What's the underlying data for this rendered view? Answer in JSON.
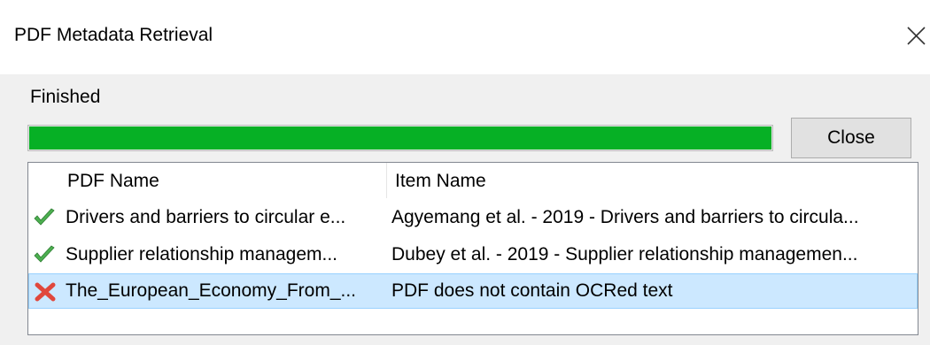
{
  "window": {
    "title": "PDF Metadata Retrieval"
  },
  "status": {
    "text": "Finished",
    "progress_percent": 100,
    "progress_color": "#06b025"
  },
  "buttons": {
    "close_label": "Close"
  },
  "table": {
    "columns": [
      "PDF Name",
      "Item Name"
    ],
    "rows": [
      {
        "status_icon": "check-icon",
        "pdf_name": "Drivers and barriers to circular e...",
        "item_name": "Agyemang et al. - 2019 - Drivers and barriers to circula...",
        "selected": false
      },
      {
        "status_icon": "check-icon",
        "pdf_name": "Supplier relationship managem...",
        "item_name": "Dubey et al. - 2019 - Supplier relationship managemen...",
        "selected": false
      },
      {
        "status_icon": "error-x-icon",
        "pdf_name": "The_European_Economy_From_...",
        "item_name": "PDF does not contain OCRed text",
        "selected": true
      }
    ]
  },
  "colors": {
    "selection_bg": "#cce8ff",
    "check_green": "#4caf50",
    "error_red": "#e0473c"
  }
}
